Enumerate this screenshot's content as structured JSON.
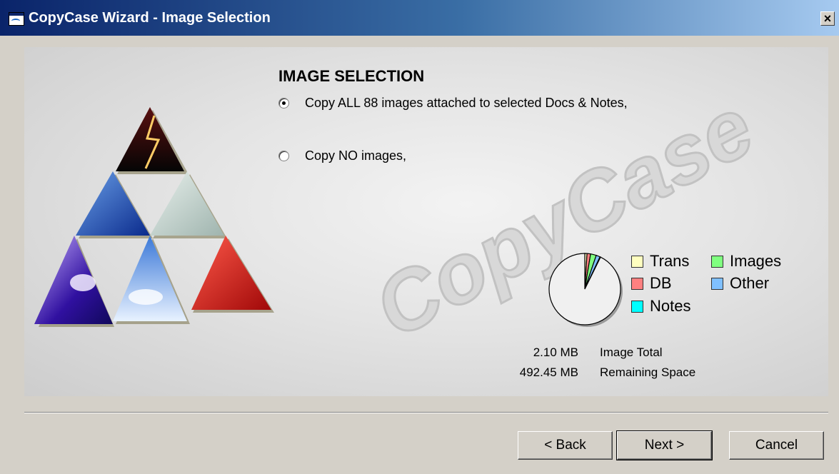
{
  "window": {
    "title": "CopyCase Wizard - Image Selection",
    "close_label": "×"
  },
  "watermark_text": "CopyCase",
  "content": {
    "heading": "IMAGE SELECTION",
    "options": [
      {
        "label": "Copy ALL 88 images attached to selected Docs & Notes,",
        "selected": true
      },
      {
        "label": "Copy NO images,",
        "selected": false
      }
    ]
  },
  "chart_data": {
    "type": "pie",
    "slices": [
      {
        "name": "Trans",
        "value": 1,
        "color": "#ffffc0"
      },
      {
        "name": "DB",
        "value": 1.6,
        "color": "#ff8080"
      },
      {
        "name": "Images",
        "value": 2.6,
        "color": "#80ff80"
      },
      {
        "name": "Other",
        "value": 1.8,
        "color": "#80c0ff"
      },
      {
        "name": "Notes",
        "value": 0.3,
        "color": "#00ffff"
      },
      {
        "name": "",
        "value": 92.7,
        "color": "#f0f0f0"
      }
    ]
  },
  "legend": [
    {
      "label": "Trans",
      "color": "#ffffc0"
    },
    {
      "label": "Images",
      "color": "#80ff80"
    },
    {
      "label": "DB",
      "color": "#ff8080"
    },
    {
      "label": "Other",
      "color": "#80c0ff"
    },
    {
      "label": "Notes",
      "color": "#00ffff"
    }
  ],
  "stats": [
    {
      "value": "2.10 MB",
      "label": "Image Total"
    },
    {
      "value": "492.45 MB",
      "label": "Remaining Space"
    }
  ],
  "buttons": {
    "back": "< Back",
    "next": "Next >",
    "cancel": "Cancel"
  }
}
